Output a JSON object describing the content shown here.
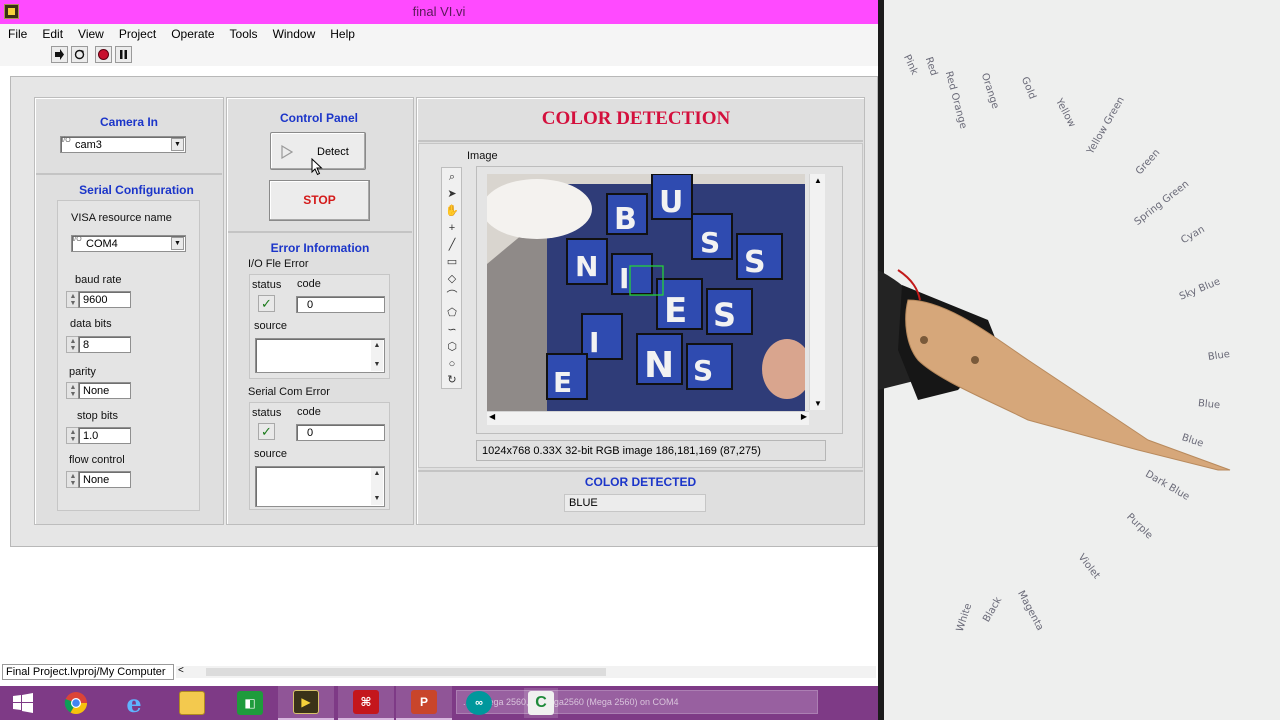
{
  "window": {
    "title": "final VI.vi",
    "controls": {
      "minimize": "–",
      "maximize": "☐",
      "close": "✕"
    }
  },
  "menu": [
    "File",
    "Edit",
    "View",
    "Project",
    "Operate",
    "Tools",
    "Window",
    "Help"
  ],
  "camera_in": {
    "title": "Camera In",
    "value": "cam3"
  },
  "serial_config": {
    "title": "Serial Configuration",
    "visa_label": "VISA resource name",
    "visa_value": "COM4",
    "baud_label": "baud rate",
    "baud_value": "9600",
    "databits_label": "data bits",
    "databits_value": "8",
    "parity_label": "parity",
    "parity_value": "None",
    "stopbits_label": "stop bits",
    "stopbits_value": "1.0",
    "flow_label": "flow control",
    "flow_value": "None"
  },
  "control_panel": {
    "title": "Control Panel",
    "detect_label": "Detect",
    "stop_label": "STOP"
  },
  "error_info": {
    "title": "Error Information",
    "io_title": "I/O Fle Error",
    "serial_title": "Serial Com Error",
    "status_label": "status",
    "code_label": "code",
    "source_label": "source",
    "io_code": "0",
    "serial_code": "0",
    "status_glyph": "✓"
  },
  "color_detection": {
    "title": "COLOR DETECTION",
    "image_label": "Image",
    "image_status": "1024x768 0.33X 32-bit RGB image 186,181,169    (87,275)",
    "detected_title": "COLOR DETECTED",
    "detected_value": "BLUE"
  },
  "bottom_status": {
    "path": "Final Project.lvproj/My Computer",
    "scroll_left": "<"
  },
  "taskbar": {
    "tooltip": "...or Mega 2560, ATmega2560 (Mega 2560) on COM4",
    "apps": [
      "windows-start",
      "chrome",
      "internet-explorer",
      "file-explorer",
      "excel-like",
      "labview",
      "acrobat",
      "powerpoint",
      "arduino",
      "code-editor"
    ]
  },
  "paper_words": [
    "Pink",
    "Red",
    "Red Orange",
    "Orange",
    "Gold",
    "Yellow",
    "Yellow Green",
    "Green",
    "Spring Green",
    "Cyan",
    "Sky Blue",
    "Blue",
    "Blue",
    "Blue",
    "Dark Blue",
    "Purple",
    "Violet",
    "Magenta",
    "Black",
    "White"
  ],
  "colors": {
    "titlebar": "#ff4aff",
    "section_title": "#1b35c9",
    "heading_red": "#d4103d",
    "taskbar": "#7e3a86"
  }
}
